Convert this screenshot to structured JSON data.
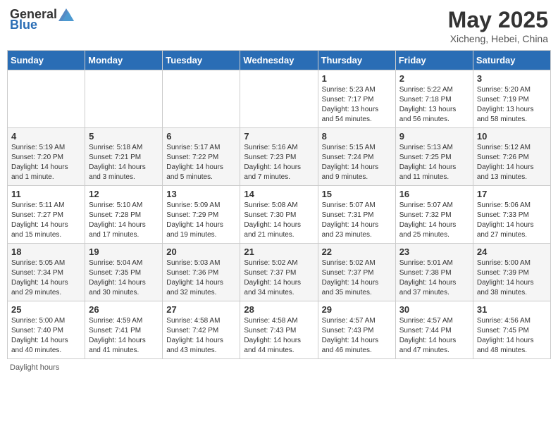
{
  "header": {
    "logo_general": "General",
    "logo_blue": "Blue",
    "title": "May 2025",
    "subtitle": "Xicheng, Hebei, China"
  },
  "days_of_week": [
    "Sunday",
    "Monday",
    "Tuesday",
    "Wednesday",
    "Thursday",
    "Friday",
    "Saturday"
  ],
  "weeks": [
    [
      {
        "day": "",
        "info": ""
      },
      {
        "day": "",
        "info": ""
      },
      {
        "day": "",
        "info": ""
      },
      {
        "day": "",
        "info": ""
      },
      {
        "day": "1",
        "info": "Sunrise: 5:23 AM\nSunset: 7:17 PM\nDaylight: 13 hours and 54 minutes."
      },
      {
        "day": "2",
        "info": "Sunrise: 5:22 AM\nSunset: 7:18 PM\nDaylight: 13 hours and 56 minutes."
      },
      {
        "day": "3",
        "info": "Sunrise: 5:20 AM\nSunset: 7:19 PM\nDaylight: 13 hours and 58 minutes."
      }
    ],
    [
      {
        "day": "4",
        "info": "Sunrise: 5:19 AM\nSunset: 7:20 PM\nDaylight: 14 hours and 1 minute."
      },
      {
        "day": "5",
        "info": "Sunrise: 5:18 AM\nSunset: 7:21 PM\nDaylight: 14 hours and 3 minutes."
      },
      {
        "day": "6",
        "info": "Sunrise: 5:17 AM\nSunset: 7:22 PM\nDaylight: 14 hours and 5 minutes."
      },
      {
        "day": "7",
        "info": "Sunrise: 5:16 AM\nSunset: 7:23 PM\nDaylight: 14 hours and 7 minutes."
      },
      {
        "day": "8",
        "info": "Sunrise: 5:15 AM\nSunset: 7:24 PM\nDaylight: 14 hours and 9 minutes."
      },
      {
        "day": "9",
        "info": "Sunrise: 5:13 AM\nSunset: 7:25 PM\nDaylight: 14 hours and 11 minutes."
      },
      {
        "day": "10",
        "info": "Sunrise: 5:12 AM\nSunset: 7:26 PM\nDaylight: 14 hours and 13 minutes."
      }
    ],
    [
      {
        "day": "11",
        "info": "Sunrise: 5:11 AM\nSunset: 7:27 PM\nDaylight: 14 hours and 15 minutes."
      },
      {
        "day": "12",
        "info": "Sunrise: 5:10 AM\nSunset: 7:28 PM\nDaylight: 14 hours and 17 minutes."
      },
      {
        "day": "13",
        "info": "Sunrise: 5:09 AM\nSunset: 7:29 PM\nDaylight: 14 hours and 19 minutes."
      },
      {
        "day": "14",
        "info": "Sunrise: 5:08 AM\nSunset: 7:30 PM\nDaylight: 14 hours and 21 minutes."
      },
      {
        "day": "15",
        "info": "Sunrise: 5:07 AM\nSunset: 7:31 PM\nDaylight: 14 hours and 23 minutes."
      },
      {
        "day": "16",
        "info": "Sunrise: 5:07 AM\nSunset: 7:32 PM\nDaylight: 14 hours and 25 minutes."
      },
      {
        "day": "17",
        "info": "Sunrise: 5:06 AM\nSunset: 7:33 PM\nDaylight: 14 hours and 27 minutes."
      }
    ],
    [
      {
        "day": "18",
        "info": "Sunrise: 5:05 AM\nSunset: 7:34 PM\nDaylight: 14 hours and 29 minutes."
      },
      {
        "day": "19",
        "info": "Sunrise: 5:04 AM\nSunset: 7:35 PM\nDaylight: 14 hours and 30 minutes."
      },
      {
        "day": "20",
        "info": "Sunrise: 5:03 AM\nSunset: 7:36 PM\nDaylight: 14 hours and 32 minutes."
      },
      {
        "day": "21",
        "info": "Sunrise: 5:02 AM\nSunset: 7:37 PM\nDaylight: 14 hours and 34 minutes."
      },
      {
        "day": "22",
        "info": "Sunrise: 5:02 AM\nSunset: 7:37 PM\nDaylight: 14 hours and 35 minutes."
      },
      {
        "day": "23",
        "info": "Sunrise: 5:01 AM\nSunset: 7:38 PM\nDaylight: 14 hours and 37 minutes."
      },
      {
        "day": "24",
        "info": "Sunrise: 5:00 AM\nSunset: 7:39 PM\nDaylight: 14 hours and 38 minutes."
      }
    ],
    [
      {
        "day": "25",
        "info": "Sunrise: 5:00 AM\nSunset: 7:40 PM\nDaylight: 14 hours and 40 minutes."
      },
      {
        "day": "26",
        "info": "Sunrise: 4:59 AM\nSunset: 7:41 PM\nDaylight: 14 hours and 41 minutes."
      },
      {
        "day": "27",
        "info": "Sunrise: 4:58 AM\nSunset: 7:42 PM\nDaylight: 14 hours and 43 minutes."
      },
      {
        "day": "28",
        "info": "Sunrise: 4:58 AM\nSunset: 7:43 PM\nDaylight: 14 hours and 44 minutes."
      },
      {
        "day": "29",
        "info": "Sunrise: 4:57 AM\nSunset: 7:43 PM\nDaylight: 14 hours and 46 minutes."
      },
      {
        "day": "30",
        "info": "Sunrise: 4:57 AM\nSunset: 7:44 PM\nDaylight: 14 hours and 47 minutes."
      },
      {
        "day": "31",
        "info": "Sunrise: 4:56 AM\nSunset: 7:45 PM\nDaylight: 14 hours and 48 minutes."
      }
    ]
  ],
  "footer": {
    "note": "Daylight hours"
  }
}
